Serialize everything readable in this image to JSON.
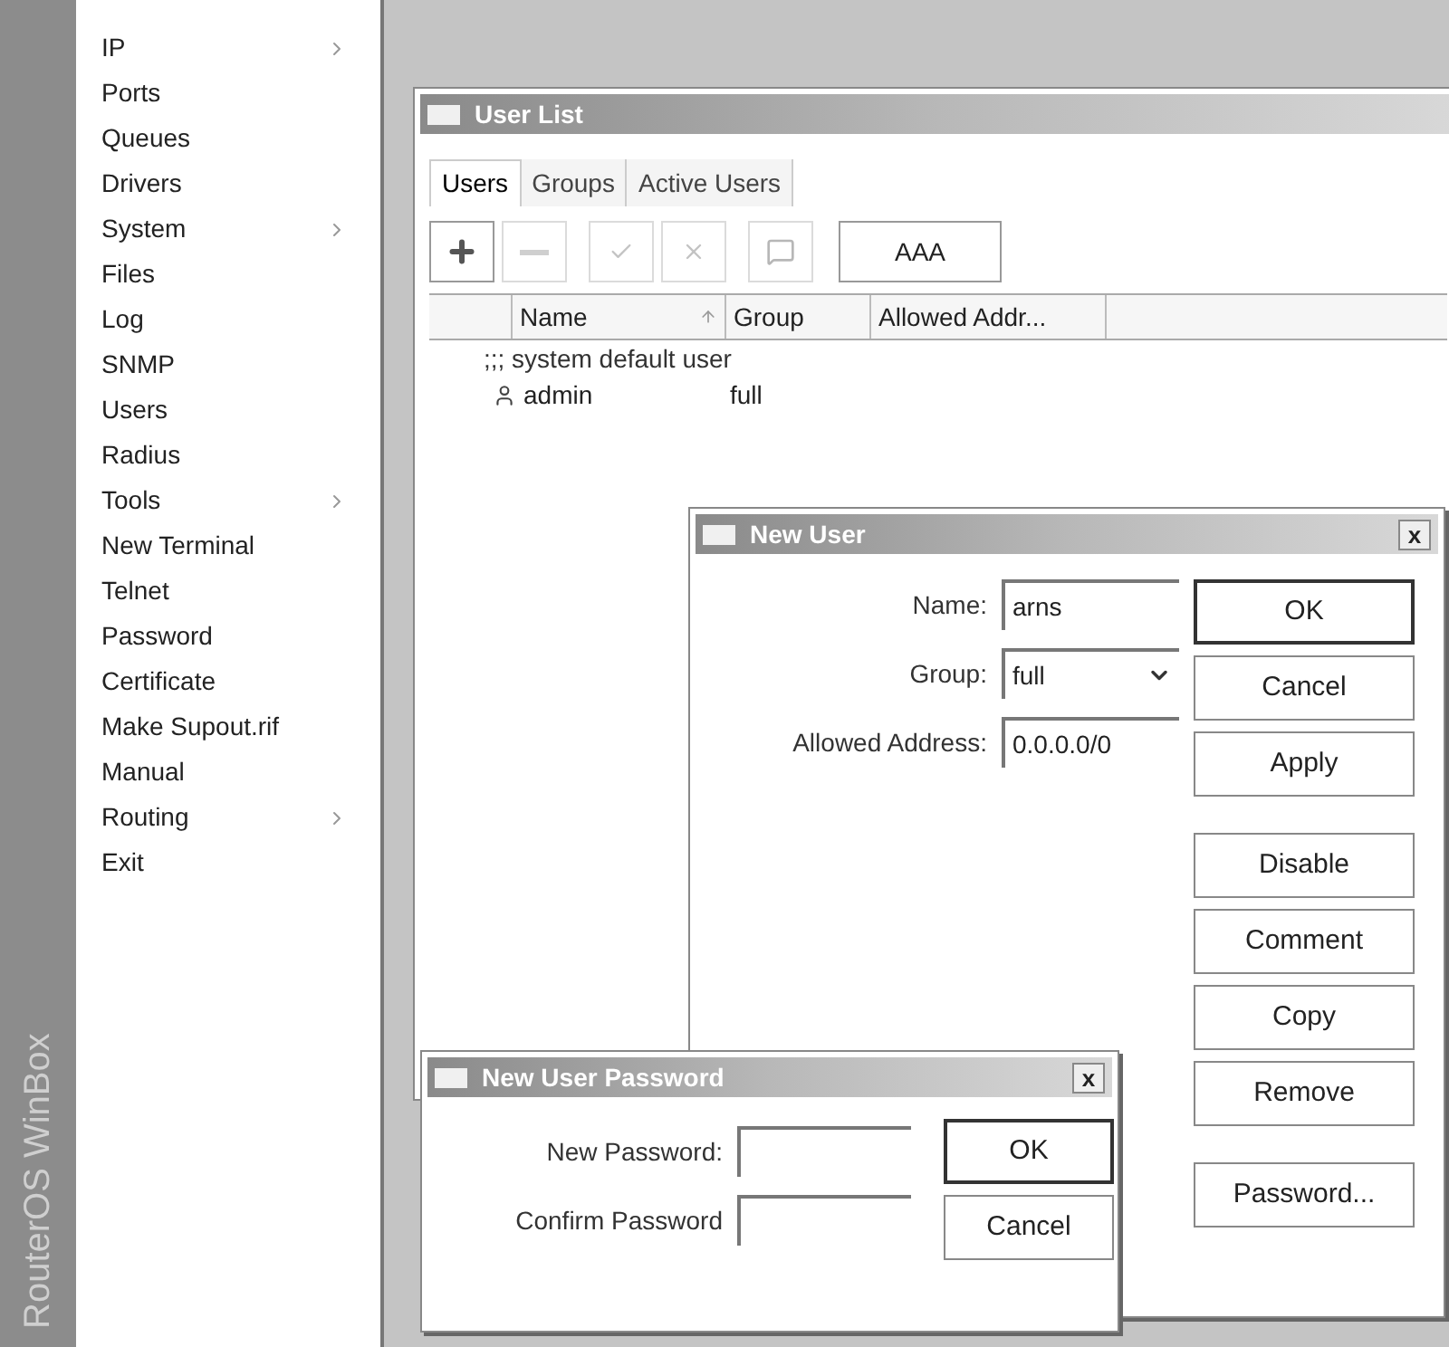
{
  "sidebar": {
    "brand": "RouterOS WinBox",
    "items": [
      {
        "label": "IP",
        "submenu": true
      },
      {
        "label": "Ports",
        "submenu": false
      },
      {
        "label": "Queues",
        "submenu": false
      },
      {
        "label": "Drivers",
        "submenu": false
      },
      {
        "label": "System",
        "submenu": true
      },
      {
        "label": "Files",
        "submenu": false
      },
      {
        "label": "Log",
        "submenu": false
      },
      {
        "label": "SNMP",
        "submenu": false
      },
      {
        "label": "Users",
        "submenu": false
      },
      {
        "label": "Radius",
        "submenu": false
      },
      {
        "label": "Tools",
        "submenu": true
      },
      {
        "label": "New Terminal",
        "submenu": false
      },
      {
        "label": "Telnet",
        "submenu": false
      },
      {
        "label": "Password",
        "submenu": false
      },
      {
        "label": "Certificate",
        "submenu": false
      },
      {
        "label": "Make Supout.rif",
        "submenu": false
      },
      {
        "label": "Manual",
        "submenu": false
      },
      {
        "label": "Routing",
        "submenu": true
      },
      {
        "label": "Exit",
        "submenu": false
      }
    ]
  },
  "user_list": {
    "title": "User List",
    "tabs": [
      {
        "label": "Users",
        "selected": true
      },
      {
        "label": "Groups",
        "selected": false
      },
      {
        "label": "Active Users",
        "selected": false
      }
    ],
    "toolbar": [
      {
        "kind": "add",
        "disabled": false
      },
      {
        "kind": "remove",
        "disabled": true
      },
      {
        "kind": "enable",
        "disabled": true
      },
      {
        "kind": "disable",
        "disabled": true
      },
      {
        "kind": "comment",
        "disabled": true
      },
      {
        "kind": "text",
        "label": "AAA",
        "disabled": false
      }
    ],
    "table": {
      "columns": [
        "Name",
        "Group",
        "Allowed Addr..."
      ],
      "rows": [
        {
          "kind": "comment",
          "text": ";;; system default user"
        },
        {
          "kind": "user",
          "name": "admin",
          "group": "full"
        }
      ]
    }
  },
  "new_user": {
    "title": "New User",
    "close": "x",
    "fields": [
      {
        "label": "Name:",
        "value": "arns",
        "kind": "text"
      },
      {
        "label": "Group:",
        "value": "full",
        "kind": "select"
      },
      {
        "label": "Allowed Address:",
        "value": "0.0.0.0/0",
        "kind": "text"
      }
    ],
    "button_groups": [
      [
        {
          "label": "OK",
          "default": true
        },
        {
          "label": "Cancel",
          "default": false
        },
        {
          "label": "Apply",
          "default": false
        }
      ],
      [
        {
          "label": "Disable",
          "default": false
        },
        {
          "label": "Comment",
          "default": false
        },
        {
          "label": "Copy",
          "default": false
        },
        {
          "label": "Remove",
          "default": false
        }
      ],
      [
        {
          "label": "Password...",
          "default": false
        }
      ]
    ]
  },
  "password_dialog": {
    "title": "New User Password",
    "close": "x",
    "fields": [
      {
        "label": "New Password:"
      },
      {
        "label": "Confirm Password"
      }
    ],
    "buttons": [
      {
        "label": "OK",
        "default": true
      },
      {
        "label": "Cancel",
        "default": false
      }
    ]
  }
}
